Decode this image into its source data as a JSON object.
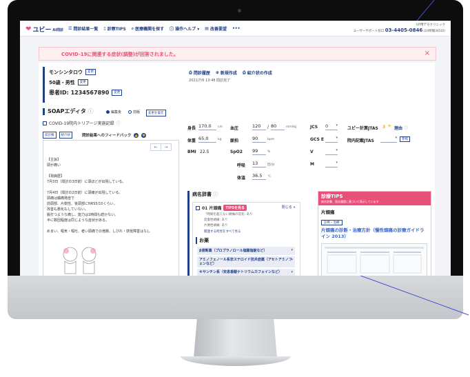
{
  "colors": {
    "brand": "#1f3f86",
    "accent": "#e8507a"
  },
  "header": {
    "brand": "ユビー",
    "brand_suffix": "AI問診",
    "nav": [
      {
        "label": "問診結果一覧",
        "icon": "list-icon"
      },
      {
        "label": "診察TIPS",
        "icon": "bookmark-icon"
      },
      {
        "label": "医療機関を探す",
        "icon": "search-icon"
      },
      {
        "label": "操作ヘルプ ▾",
        "icon": "info-icon"
      },
      {
        "label": "改善要望",
        "icon": "message-icon"
      },
      {
        "label": "•••",
        "icon": "more-icon"
      }
    ],
    "clinic": "UP用デモクリニック",
    "support_label": "ユーザーサポート窓口",
    "support_tel": "03-4405-0846",
    "support_hours": "(24時間365日)"
  },
  "alert": {
    "text": "COVID-19に関連する症状(調整)が回答されました。",
    "close": "×"
  },
  "patient": {
    "name": "モンシンタロウ",
    "age_sex": "50歳・男性",
    "id": "患者ID: 1234567890",
    "change": "変更"
  },
  "links": [
    {
      "label": "問診履歴",
      "icon": "history-icon"
    },
    {
      "label": "新規作成",
      "icon": "plus-icon"
    },
    {
      "label": "紹介状の作成",
      "icon": "print-icon"
    }
  ],
  "timestamp": "2021/7/6 13:48 問診完了",
  "soap": {
    "title": "SOAPエディタ",
    "radio_edit": "編集後",
    "radio_before": "前版",
    "restore_btn": "変更を復元",
    "covid_check": "COVID-19院内トリアージ実施記録",
    "btn_zenhou": "前診察",
    "btn_shokai": "紹介状",
    "feedback": "問診結果へのフィードバック",
    "nav_prev": "←",
    "nav_next": "→",
    "note_lines": [
      "【主訴】",
      "頭が痛い",
      "",
      "【現病歴】",
      "7月3日（問診の3日前）に頭ほどが出現している。",
      "",
      "7月4日（問診の2日前）に頭痛が出現している。",
      "頭痛は鎮痛発症で",
      "前頭部、片側性、後頭部にNRS5/10くらい。",
      "改善も悪化もしていない。",
      "脈打つような痛し、能力は1時間も続かない。",
      "半に数回程度は同じような症状がある。",
      "",
      "めまい、嘔気・嘔吐、者い頭痛での増悪、しびれ・感覚障害はなし"
    ]
  },
  "vitals": {
    "height_label": "身長",
    "height": "170.0",
    "height_unit": "cm",
    "weight_label": "体重",
    "weight": "65.0",
    "weight_unit": "kg",
    "bmi_label": "BMI",
    "bmi": "22.5",
    "bp_label": "血圧",
    "bp_sys": "120",
    "bp_dia": "80",
    "bp_unit": "mmHg",
    "pulse_label": "脈拍",
    "pulse": "90",
    "pulse_unit": "bpm",
    "spo2_label": "SpO2",
    "spo2": "99",
    "spo2_unit": "%",
    "resp_label": "呼吸",
    "resp": "13",
    "resp_unit": "回/分",
    "temp_label": "体温",
    "temp": "36.5",
    "temp_unit": "℃",
    "jcs_label": "JCS",
    "jcs": "0",
    "gcs_label": "GCS E",
    "v_label": "V",
    "m_label": "M",
    "jtas_label": "ユビー計算JTAS",
    "jtas_value": "3",
    "jtas_tag": "理由",
    "injtas_label": "院内記載JTAS",
    "injtas_btn": "参照"
  },
  "dx": {
    "title": "病名辞書",
    "item_label": "01 片頭痛",
    "item_badge": "TIPSを見る",
    "item_close": "閉じる ∧",
    "lines": [
      "「時間を超えない頭痛の前兆: あり",
      "反復性頭痛: あり",
      "片側性頭痛: あり"
    ],
    "more": "関連する所見をすべて見る",
    "drugs_title": "お薬",
    "drugs": [
      "β遮断薬（プロプラノロール塩酸塩錠など）",
      "アミノフェノール系非ステロイド抗炎症薬（アセトアミノフェンなど）",
      "キサンチン系（安息香酸ナトリウムカフェインなど）"
    ]
  },
  "tips": {
    "title": "診療TIPS",
    "subtitle": "病名辞書、過去履歴に基づいて表示しています",
    "section": "片頭痛",
    "tag": "診断・治療",
    "article": "片頭痛の診断・治療方針（慢性頭痛の診療ガイドライン 2013）"
  }
}
